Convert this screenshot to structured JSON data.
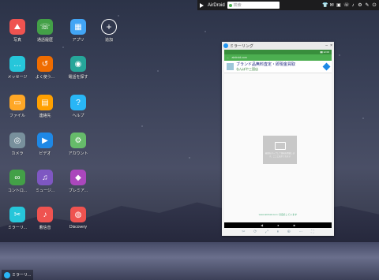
{
  "topbar": {
    "brand": "AirDroid",
    "search_placeholder": "検索",
    "icons": [
      "shirt-icon",
      "mail-icon",
      "contacts-icon",
      "phone-icon",
      "bell-icon",
      "gear-icon",
      "pen-icon",
      "power-icon"
    ]
  },
  "apps": [
    {
      "label": "写真",
      "icon": "photos-icon",
      "color": "#ef5350"
    },
    {
      "label": "通話履歴",
      "icon": "phone-icon",
      "color": "#43a047"
    },
    {
      "label": "アプリ",
      "icon": "grid-icon",
      "color": "#42a5f5"
    },
    {
      "label": "追加",
      "icon": "plus-icon",
      "color": "transparent"
    },
    {
      "label": "メッセージ",
      "icon": "message-icon",
      "color": "#26c6da"
    },
    {
      "label": "よく使う...",
      "icon": "frequent-icon",
      "color": "#ef6c00"
    },
    {
      "label": "電話を探す",
      "icon": "location-icon",
      "color": "#26a69a"
    },
    {
      "label": "ファイル",
      "icon": "folder-icon",
      "color": "#ffa726"
    },
    {
      "label": "連絡先",
      "icon": "contacts-icon",
      "color": "#ffa000"
    },
    {
      "label": "ヘルプ",
      "icon": "help-icon",
      "color": "#29b6f6"
    },
    {
      "label": "カメラ",
      "icon": "camera-icon",
      "color": "#78909c"
    },
    {
      "label": "ビデオ",
      "icon": "video-icon",
      "color": "#1e88e5"
    },
    {
      "label": "アカウント",
      "icon": "gear-icon",
      "color": "#66bb6a"
    },
    {
      "label": "コントロ...",
      "icon": "binoculars-icon",
      "color": "#43a047"
    },
    {
      "label": "ミュージ...",
      "icon": "music-icon",
      "color": "#7e57c2"
    },
    {
      "label": "プレミア...",
      "icon": "diamond-icon",
      "color": "#ab47bc"
    },
    {
      "label": "ミラーリ...",
      "icon": "scissors-icon",
      "color": "#26c6da"
    },
    {
      "label": "着信音",
      "icon": "bell-icon",
      "color": "#ef5350"
    },
    {
      "label": "Discovery",
      "icon": "planet-icon",
      "color": "#ef5350"
    }
  ],
  "mirror": {
    "title": "ミラーリング",
    "close": "×",
    "minimize": "–",
    "phone_url": "airdroid.com",
    "ad_title": "ブランド品無料査定・即現金買取",
    "ad_sub": "なんぼや三国店",
    "cast_text": "画面をタップして録画を開始します、ここに表示されます",
    "hint": "www.airdroid.com で接続しています",
    "nav": [
      "◀",
      "●",
      "■"
    ],
    "tools": [
      "✂",
      "⟳",
      "⤢",
      "⏸",
      "⊕",
      "⋯",
      "⛶"
    ]
  },
  "taskbar": {
    "label": "ミラーリ..."
  }
}
